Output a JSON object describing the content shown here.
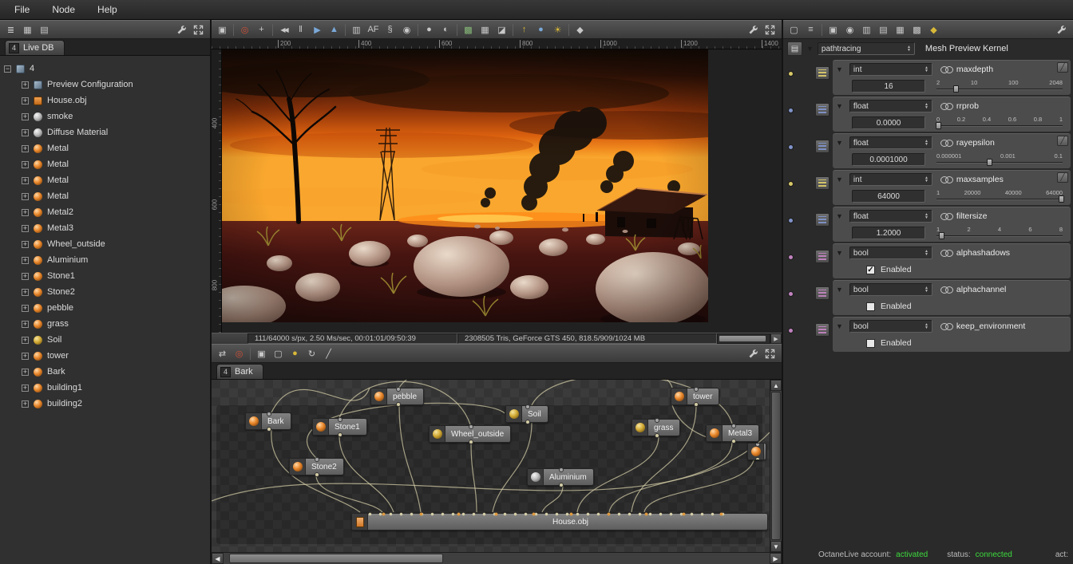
{
  "window": {
    "menu": [
      "File",
      "Node",
      "Help"
    ]
  },
  "glyphs": {
    "plus": "+",
    "minus": "−",
    "down_arrow": "▼",
    "up_arrow": "▲",
    "spin_up": "▲",
    "spin_down": "▼",
    "left_arrow": "◀",
    "right_arrow": "▶",
    "slash": "╱"
  },
  "toolbars": {
    "left": [
      {
        "name": "sync-tree",
        "glyph": "≣"
      },
      {
        "name": "save-scene",
        "glyph": "▦"
      },
      {
        "name": "save-scene-as",
        "glyph": "▤"
      }
    ],
    "center": [
      {
        "name": "save-render",
        "glyph": "▣"
      },
      {
        "name": "white-balance-picker",
        "glyph": "◎"
      },
      {
        "name": "focus-picker",
        "glyph": "+"
      },
      {
        "name": "restart-render",
        "glyph": "◀◀"
      },
      {
        "name": "pause-render",
        "glyph": "‖"
      },
      {
        "name": "resume-render",
        "glyph": "▶"
      },
      {
        "name": "render-region",
        "glyph": "▲"
      },
      {
        "name": "clay-mode",
        "glyph": "▥"
      },
      {
        "name": "auto-focus",
        "glyph": "AF"
      },
      {
        "name": "imager-settings",
        "glyph": "§"
      },
      {
        "name": "camera-settings",
        "glyph": "◉"
      },
      {
        "name": "lock-exposure",
        "glyph": "●"
      },
      {
        "name": "tone-map",
        "glyph": "◐"
      },
      {
        "name": "alpha-checker",
        "glyph": "▩"
      },
      {
        "name": "background-checker",
        "glyph": "▦"
      },
      {
        "name": "subsample",
        "glyph": "◪"
      },
      {
        "name": "upload-livedb",
        "glyph": "↑"
      },
      {
        "name": "octane-live",
        "glyph": "●"
      },
      {
        "name": "daylight",
        "glyph": "☀"
      },
      {
        "name": "material-preview",
        "glyph": "◆"
      }
    ],
    "graph": [
      {
        "name": "pan-view",
        "glyph": "⇄"
      },
      {
        "name": "material-picker",
        "glyph": "◎"
      },
      {
        "name": "group-nodes",
        "glyph": "▣"
      },
      {
        "name": "add-node",
        "glyph": "▢"
      },
      {
        "name": "material-ball",
        "glyph": "●"
      },
      {
        "name": "refresh-graph",
        "glyph": "↻"
      },
      {
        "name": "cut-connections",
        "glyph": "╱"
      }
    ],
    "right": [
      {
        "name": "copy-node",
        "glyph": "▢"
      },
      {
        "name": "node-list",
        "glyph": "≡"
      },
      {
        "name": "render-target",
        "glyph": "▣"
      },
      {
        "name": "history",
        "glyph": "◉"
      },
      {
        "name": "storage",
        "glyph": "▥"
      },
      {
        "name": "presets",
        "glyph": "▤"
      },
      {
        "name": "texture-image",
        "glyph": "▦"
      },
      {
        "name": "checker-node",
        "glyph": "▩"
      },
      {
        "name": "material-drop",
        "glyph": "◆"
      }
    ]
  },
  "outliner": {
    "tab_index": "4",
    "tab_label": "Live DB",
    "root_label": "4",
    "items": [
      {
        "label": "Preview Configuration",
        "icon": "render-target"
      },
      {
        "label": "House.obj",
        "icon": "mesh"
      },
      {
        "label": "smoke",
        "icon": "material-gray"
      },
      {
        "label": "Diffuse Material",
        "icon": "material-gray"
      },
      {
        "label": "Metal",
        "icon": "material-orange"
      },
      {
        "label": "Metal",
        "icon": "material-orange"
      },
      {
        "label": "Metal",
        "icon": "material-orange"
      },
      {
        "label": "Metal",
        "icon": "material-orange"
      },
      {
        "label": "Metal2",
        "icon": "material-orange"
      },
      {
        "label": "Metal3",
        "icon": "material-orange"
      },
      {
        "label": "Wheel_outside",
        "icon": "material-orange"
      },
      {
        "label": "Aluminium",
        "icon": "material-orange"
      },
      {
        "label": "Stone1",
        "icon": "material-orange"
      },
      {
        "label": "Stone2",
        "icon": "material-orange"
      },
      {
        "label": "pebble",
        "icon": "material-orange"
      },
      {
        "label": "grass",
        "icon": "material-orange"
      },
      {
        "label": "Soil",
        "icon": "material-yellow"
      },
      {
        "label": "tower",
        "icon": "material-orange"
      },
      {
        "label": "Bark",
        "icon": "material-orange"
      },
      {
        "label": "building1",
        "icon": "material-orange"
      },
      {
        "label": "building2",
        "icon": "material-orange"
      }
    ]
  },
  "viewport": {
    "ruler_top": [
      "200",
      "400",
      "600",
      "800",
      "1000",
      "1200",
      "1400"
    ],
    "ruler_left": [
      "400",
      "600",
      "800"
    ],
    "status_left": "111/64000 s/px, 2.50 Ms/sec, 00:01:01/09:50:39",
    "status_right": "2308505 Tris, GeForce GTS 450, 818.5/909/1024 MB"
  },
  "graph": {
    "tab_index": "4",
    "tab_label": "Bark",
    "nodes": [
      {
        "label": "pebble"
      },
      {
        "label": "tower"
      },
      {
        "label": "Soil"
      },
      {
        "label": "Bark"
      },
      {
        "label": "Stone1"
      },
      {
        "label": "Wheel_outside"
      },
      {
        "label": "grass"
      },
      {
        "label": "Metal3"
      },
      {
        "label": "Stone2"
      },
      {
        "label": "Aluminium"
      },
      {
        "label": "House.obj"
      }
    ]
  },
  "inspector": {
    "type_value": "pathtracing",
    "title": "Mesh Preview Kernel",
    "params": [
      {
        "name": "maxdepth",
        "type": "int",
        "value": "16",
        "ticks": [
          "2",
          "10",
          "100",
          "2048"
        ],
        "pin_color": "#d8c868",
        "has_toggle": true
      },
      {
        "name": "rrprob",
        "type": "float",
        "value": "0.0000",
        "ticks": [
          "0",
          "0.2",
          "0.4",
          "0.6",
          "0.8",
          "1"
        ],
        "pin_color": "#8093c8",
        "has_toggle": false
      },
      {
        "name": "rayepsilon",
        "type": "float",
        "value": "0.0001000",
        "ticks": [
          "0.000001",
          "0.001",
          "0.1"
        ],
        "pin_color": "#8093c8",
        "has_toggle": true
      },
      {
        "name": "maxsamples",
        "type": "int",
        "value": "64000",
        "ticks": [
          "1",
          "20000",
          "40000",
          "64000"
        ],
        "pin_color": "#d8c868",
        "has_toggle": true
      },
      {
        "name": "filtersize",
        "type": "float",
        "value": "1.2000",
        "ticks": [
          "1",
          "2",
          "4",
          "6",
          "8"
        ],
        "pin_color": "#8093c8",
        "has_toggle": false
      },
      {
        "name": "alphashadows",
        "type": "bool",
        "checkbox_label": "Enabled",
        "checked": true,
        "check_glyph": "✓",
        "pin_color": "#c083be"
      },
      {
        "name": "alphachannel",
        "type": "bool",
        "checkbox_label": "Enabled",
        "checked": false,
        "check_glyph": "",
        "pin_color": "#c083be"
      },
      {
        "name": "keep_environment",
        "type": "bool",
        "checkbox_label": "Enabled",
        "checked": false,
        "check_glyph": "",
        "pin_color": "#c083be"
      }
    ]
  },
  "statusbar": {
    "account_label": "OctaneLive account:",
    "account_value": "activated",
    "status_label": "status:",
    "status_value": "connected",
    "act_label": "act:"
  },
  "colors": {
    "status_green": "#3ddc3d",
    "pin_int": "#d8c868",
    "pin_float": "#8093c8",
    "pin_bool": "#c083be",
    "node_orange": "#e8862a"
  }
}
